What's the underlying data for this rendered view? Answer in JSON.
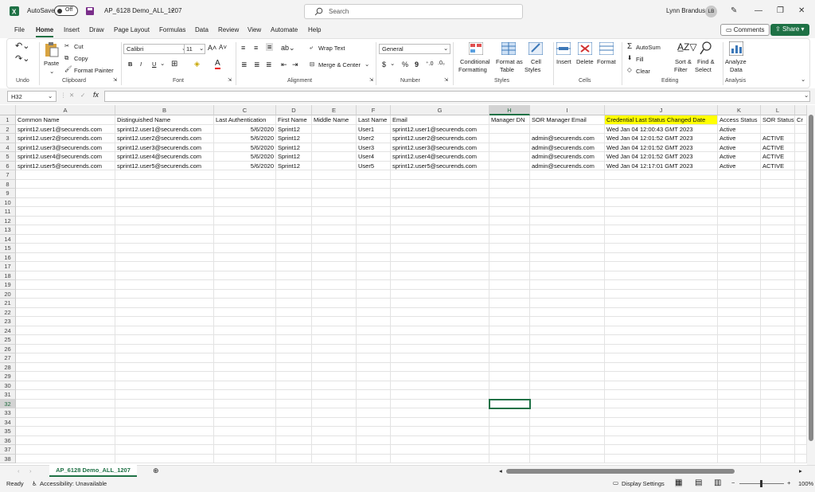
{
  "titlebar": {
    "autosave_label": "AutoSave",
    "autosave_state": "Off",
    "doc_title": "AP_6128 Demo_ALL_1207",
    "search_placeholder": "Search",
    "user_name": "Lynn Brandus",
    "user_initials": "LB"
  },
  "menu": {
    "tabs": [
      "File",
      "Home",
      "Insert",
      "Draw",
      "Page Layout",
      "Formulas",
      "Data",
      "Review",
      "View",
      "Automate",
      "Help"
    ],
    "comments": "Comments",
    "share": "Share"
  },
  "ribbon": {
    "clipboard": {
      "paste": "Paste",
      "cut": "Cut",
      "copy": "Copy",
      "format_painter": "Format Painter",
      "label": "Clipboard"
    },
    "undo_label": "Undo",
    "font": {
      "name": "Calibri",
      "size": "11",
      "label": "Font",
      "bold": "B",
      "italic": "I",
      "underline": "U"
    },
    "alignment": {
      "wrap": "Wrap Text",
      "merge": "Merge & Center",
      "label": "Alignment"
    },
    "number": {
      "format": "General",
      "label": "Number",
      "currency": "$",
      "percent": "%",
      "comma": "9"
    },
    "styles": {
      "conditional": "Conditional",
      "conditional2": "Formatting",
      "format_as": "Format as",
      "format_as2": "Table",
      "cell": "Cell",
      "cell2": "Styles",
      "label": "Styles"
    },
    "cells": {
      "insert": "Insert",
      "delete": "Delete",
      "format": "Format",
      "label": "Cells"
    },
    "editing": {
      "autosum": "AutoSum",
      "fill": "Fill",
      "clear": "Clear",
      "sort": "Sort &",
      "sort2": "Filter",
      "find": "Find &",
      "find2": "Select",
      "label": "Editing"
    },
    "analysis": {
      "analyze": "Analyze",
      "analyze2": "Data",
      "label": "Analysis"
    }
  },
  "formula_bar": {
    "name_box": "H32",
    "fx": "fx",
    "value": ""
  },
  "sheet": {
    "columns": [
      "A",
      "B",
      "C",
      "D",
      "E",
      "F",
      "G",
      "H",
      "I",
      "J",
      "K",
      "L"
    ],
    "rows": [
      "1",
      "2",
      "3",
      "4",
      "5",
      "6",
      "7",
      "8",
      "9",
      "10",
      "11",
      "12",
      "13",
      "14",
      "15",
      "16",
      "17",
      "18",
      "19",
      "20",
      "21",
      "22",
      "23",
      "24",
      "25",
      "26",
      "27",
      "28",
      "29",
      "30",
      "31",
      "32",
      "33",
      "34",
      "35",
      "36",
      "37",
      "38"
    ],
    "headers": [
      "Common Name",
      "Distinguished Name",
      "Last Authentication",
      "First Name",
      "Middle Name",
      "Last Name",
      "Email",
      "Manager DN",
      "SOR Manager Email",
      "Credential Last Status Changed Date",
      "Access Status",
      "SOR Status",
      "Cr"
    ],
    "data": [
      [
        "sprint12.user1@securends.com",
        "sprint12.user1@securends.com",
        "5/6/2020",
        "Sprint12",
        "",
        "User1",
        "sprint12.user1@securends.com",
        "",
        "",
        "Wed Jan 04 12:00:43 GMT 2023",
        "Active",
        ""
      ],
      [
        "sprint12.user2@securends.com",
        "sprint12.user2@securends.com",
        "5/6/2020",
        "Sprint12",
        "",
        "User2",
        "sprint12.user2@securends.com",
        "",
        "admin@securends.com",
        "Wed Jan 04 12:01:52 GMT 2023",
        "Active",
        "ACTIVE"
      ],
      [
        "sprint12.user3@securends.com",
        "sprint12.user3@securends.com",
        "5/6/2020",
        "Sprint12",
        "",
        "User3",
        "sprint12.user3@securends.com",
        "",
        "admin@securends.com",
        "Wed Jan 04 12:01:52 GMT 2023",
        "Active",
        "ACTIVE"
      ],
      [
        "sprint12.user4@securends.com",
        "sprint12.user4@securends.com",
        "5/6/2020",
        "Sprint12",
        "",
        "User4",
        "sprint12.user4@securends.com",
        "",
        "admin@securends.com",
        "Wed Jan 04 12:01:52 GMT 2023",
        "Active",
        "ACTIVE"
      ],
      [
        "sprint12.user5@securends.com",
        "sprint12.user5@securends.com",
        "5/6/2020",
        "Sprint12",
        "",
        "User5",
        "sprint12.user5@securends.com",
        "",
        "admin@securends.com",
        "Wed Jan 04 12:17:01 GMT 2023",
        "Active",
        "ACTIVE"
      ]
    ],
    "tab_name": "AP_6128 Demo_ALL_1207"
  },
  "status": {
    "ready": "Ready",
    "accessibility": "Accessibility: Unavailable",
    "display_settings": "Display Settings",
    "zoom": "100%"
  },
  "colors": {
    "excel_green": "#1e7145",
    "highlight": "#ffff00"
  }
}
